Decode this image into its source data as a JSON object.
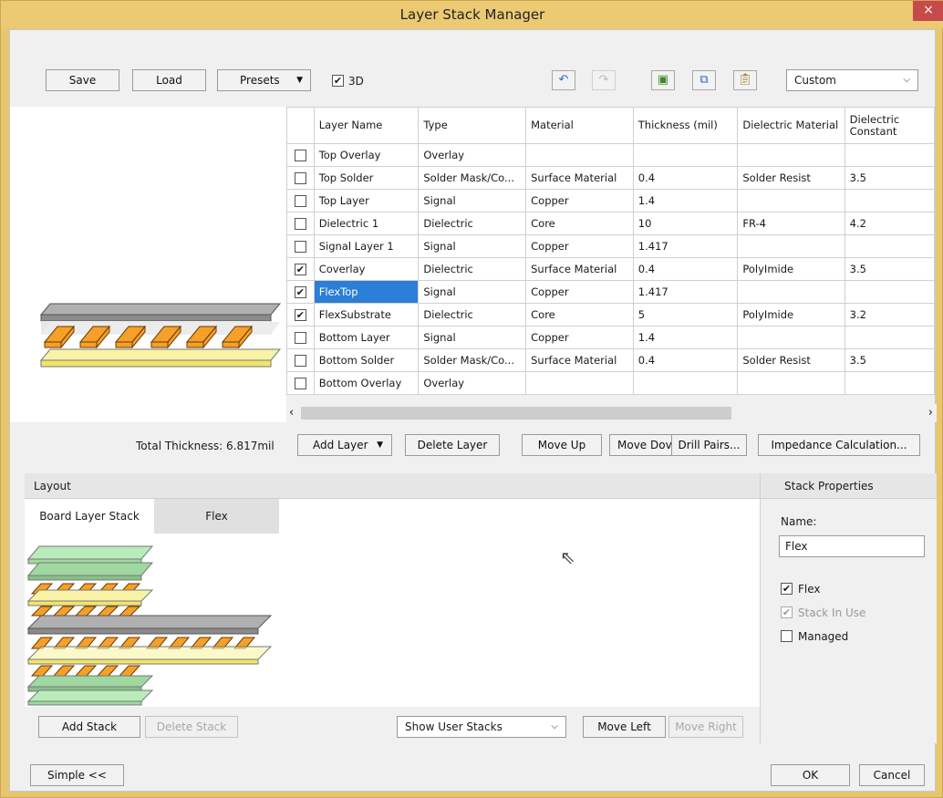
{
  "window": {
    "title": "Layer Stack Manager",
    "close": "×"
  },
  "toolbar": {
    "save": "Save",
    "load": "Load",
    "presets": "Presets",
    "threed_label": "3D",
    "threed_checked": true,
    "preset_value": "Custom"
  },
  "grid": {
    "headers": [
      "",
      "Layer Name",
      "Type",
      "Material",
      "Thickness (mil)",
      "Dielectric Material",
      "Dielectric Constant"
    ],
    "rows": [
      {
        "checked": false,
        "name": "Top Overlay",
        "type": "Overlay",
        "material": "",
        "thickness": "",
        "dmat": "",
        "dconst": ""
      },
      {
        "checked": false,
        "name": "Top Solder",
        "type": "Solder Mask/Co...",
        "material": "Surface Material",
        "thickness": "0.4",
        "dmat": "Solder Resist",
        "dconst": "3.5"
      },
      {
        "checked": false,
        "name": "Top Layer",
        "type": "Signal",
        "material": "Copper",
        "thickness": "1.4",
        "dmat": "",
        "dconst": ""
      },
      {
        "checked": false,
        "name": "Dielectric 1",
        "type": "Dielectric",
        "material": "Core",
        "thickness": "10",
        "dmat": "FR-4",
        "dconst": "4.2"
      },
      {
        "checked": false,
        "name": "Signal Layer 1",
        "type": "Signal",
        "material": "Copper",
        "thickness": "1.417",
        "dmat": "",
        "dconst": ""
      },
      {
        "checked": true,
        "name": "Coverlay",
        "type": "Dielectric",
        "material": "Surface Material",
        "thickness": "0.4",
        "dmat": "PolyImide",
        "dconst": "3.5"
      },
      {
        "checked": true,
        "name": "FlexTop",
        "type": "Signal",
        "material": "Copper",
        "thickness": "1.417",
        "dmat": "",
        "dconst": "",
        "selected": true
      },
      {
        "checked": true,
        "name": "FlexSubstrate",
        "type": "Dielectric",
        "material": "Core",
        "thickness": "5",
        "dmat": "PolyImide",
        "dconst": "3.2"
      },
      {
        "checked": false,
        "name": "Bottom Layer",
        "type": "Signal",
        "material": "Copper",
        "thickness": "1.4",
        "dmat": "",
        "dconst": ""
      },
      {
        "checked": false,
        "name": "Bottom Solder",
        "type": "Solder Mask/Co...",
        "material": "Surface Material",
        "thickness": "0.4",
        "dmat": "Solder Resist",
        "dconst": "3.5"
      },
      {
        "checked": false,
        "name": "Bottom Overlay",
        "type": "Overlay",
        "material": "",
        "thickness": "",
        "dmat": "",
        "dconst": ""
      }
    ]
  },
  "stack_actions": {
    "total_thickness": "Total Thickness: 6.817mil",
    "add_layer": "Add Layer",
    "delete_layer": "Delete Layer",
    "move_up": "Move Up",
    "move_down": "Move Dov",
    "drill_pairs": "Drill Pairs...",
    "impedance": "Impedance Calculation..."
  },
  "layout": {
    "title": "Layout",
    "tabs": [
      "Board Layer Stack",
      "Flex"
    ],
    "add_stack": "Add Stack",
    "delete_stack": "Delete Stack",
    "show_stacks": "Show User Stacks",
    "move_left": "Move Left",
    "move_right": "Move Right"
  },
  "stack_properties": {
    "title": "Stack Properties",
    "name_label": "Name:",
    "name_value": "Flex",
    "flex_label": "Flex",
    "flex_checked": true,
    "in_use_label": "Stack In Use",
    "in_use_checked": true,
    "managed_label": "Managed",
    "managed_checked": false
  },
  "footer": {
    "simple": "Simple <<",
    "ok": "OK",
    "cancel": "Cancel"
  },
  "colors": {
    "copper": "#f59a12",
    "solder": "#f5ef8a",
    "overlay": "#a9a9a9",
    "coverlay": "#9fe0a0",
    "selection": "#2b7fd6"
  }
}
